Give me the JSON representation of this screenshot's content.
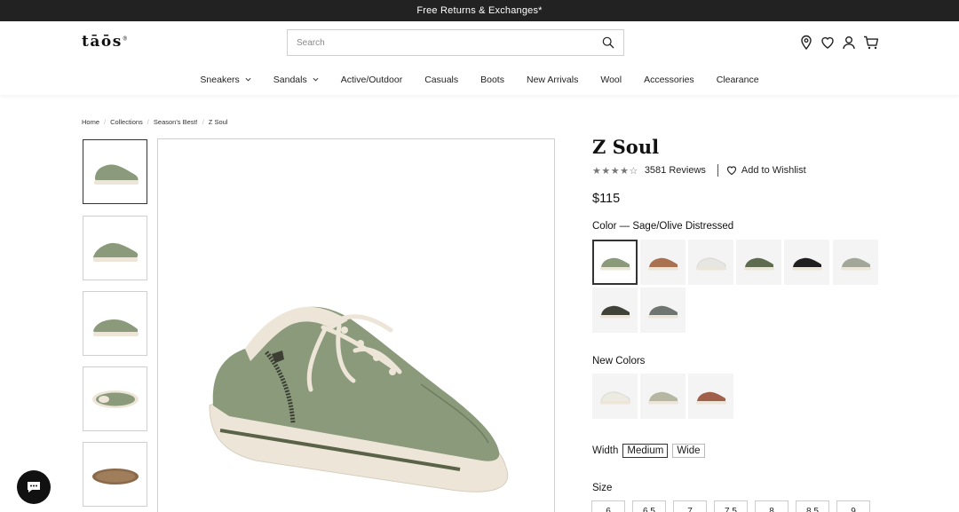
{
  "announcement": "Free Returns & Exchanges*",
  "logo": {
    "text": "tāōs",
    "mark": "®"
  },
  "search": {
    "placeholder": "Search",
    "value": ""
  },
  "header_icons": [
    "location-icon",
    "heart-icon",
    "account-icon",
    "cart-icon"
  ],
  "nav": [
    {
      "label": "Sneakers",
      "dropdown": true
    },
    {
      "label": "Sandals",
      "dropdown": true
    },
    {
      "label": "Active/Outdoor",
      "dropdown": false
    },
    {
      "label": "Casuals",
      "dropdown": false
    },
    {
      "label": "Boots",
      "dropdown": false
    },
    {
      "label": "New Arrivals",
      "dropdown": false
    },
    {
      "label": "Wool",
      "dropdown": false
    },
    {
      "label": "Accessories",
      "dropdown": false
    },
    {
      "label": "Clearance",
      "dropdown": false
    }
  ],
  "breadcrumb": [
    "Home",
    "Collections",
    "Season's Best!",
    "Z Soul"
  ],
  "product": {
    "title": "Z Soul",
    "rating": 4.5,
    "stars": "★★★★☆",
    "reviews_label": "3581 Reviews",
    "wishlist_label": "Add to Wishlist",
    "price": "$115",
    "color_label": "Color — Sage/Olive Distressed",
    "new_colors_label": "New Colors",
    "width_label": "Width",
    "width_options": [
      "Medium",
      "Wide"
    ],
    "width_selected": "Medium",
    "size_label": "Size",
    "sizes": [
      "6",
      "6.5",
      "7",
      "7.5",
      "8",
      "8.5",
      "9"
    ]
  },
  "colors": {
    "swatches": [
      "#8a9a7b",
      "#a9714f",
      "#e6e6e2",
      "#5f6b4f",
      "#1f1f1f",
      "#a3a79a",
      "#3f4236",
      "#6f7570"
    ],
    "new_swatches": [
      "#ecebe2",
      "#b6b7a3",
      "#a0604a"
    ],
    "sole": "#ede6d8",
    "chat_bg": "#111111"
  }
}
